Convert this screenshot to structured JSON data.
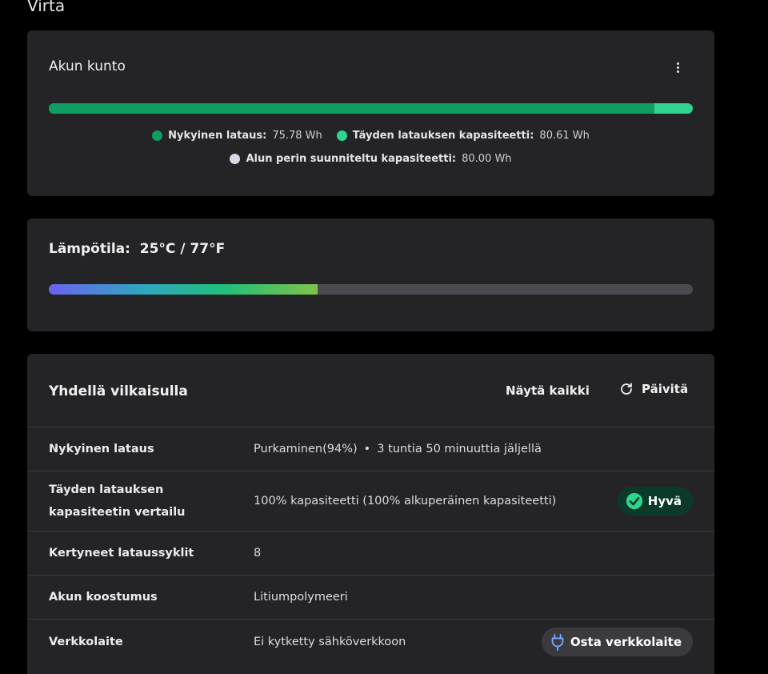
{
  "page": {
    "title": "Virta"
  },
  "battery_health": {
    "title": "Akun kunto",
    "current_charge_fraction": 0.9401,
    "legend": [
      {
        "label": "Nykyinen lataus:",
        "value": "75.78 Wh",
        "color": "#0f9d62"
      },
      {
        "label": "Täyden latauksen kapasiteetti:",
        "value": "80.61 Wh",
        "color": "#2fd58e"
      },
      {
        "label": "Alun perin suunniteltu kapasiteetti:",
        "value": "80.00 Wh",
        "color": "#d6dbe6"
      }
    ]
  },
  "temperature": {
    "label": "Lämpötila:",
    "value": "25°C / 77°F",
    "level_fraction": 0.417
  },
  "glance": {
    "title": "Yhdellä vilkaisulla",
    "show_all": "Näytä kaikki",
    "refresh": "Päivitä",
    "rows": [
      {
        "label": "Nykyinen lataus",
        "value": "Purkaminen(94%)",
        "value2": "3 tuntia 50 minuuttia jäljellä",
        "separator": "•"
      },
      {
        "label": "Täyden latauksen kapasiteetin vertailu",
        "value": "100% kapasiteetti (100% alkuperäinen kapasiteetti)",
        "badge": "Hyvä"
      },
      {
        "label": "Kertyneet lataussyklit",
        "value": "8"
      },
      {
        "label": "Akun koostumus",
        "value": "Litiumpolymeeri"
      },
      {
        "label": "Verkkolaite",
        "value": "Ei kytketty sähköverkkoon",
        "button": "Osta verkkolaite"
      }
    ]
  },
  "icons": {
    "menu": "more-vertical-icon",
    "refresh": "refresh-icon",
    "good": "check-circle-icon",
    "adapter": "plug-icon"
  },
  "colors": {
    "accent_green": "#0f9d62",
    "light_green": "#2fd58e",
    "good_check": "#2fd58e",
    "plug_blue": "#7aa7ff"
  }
}
